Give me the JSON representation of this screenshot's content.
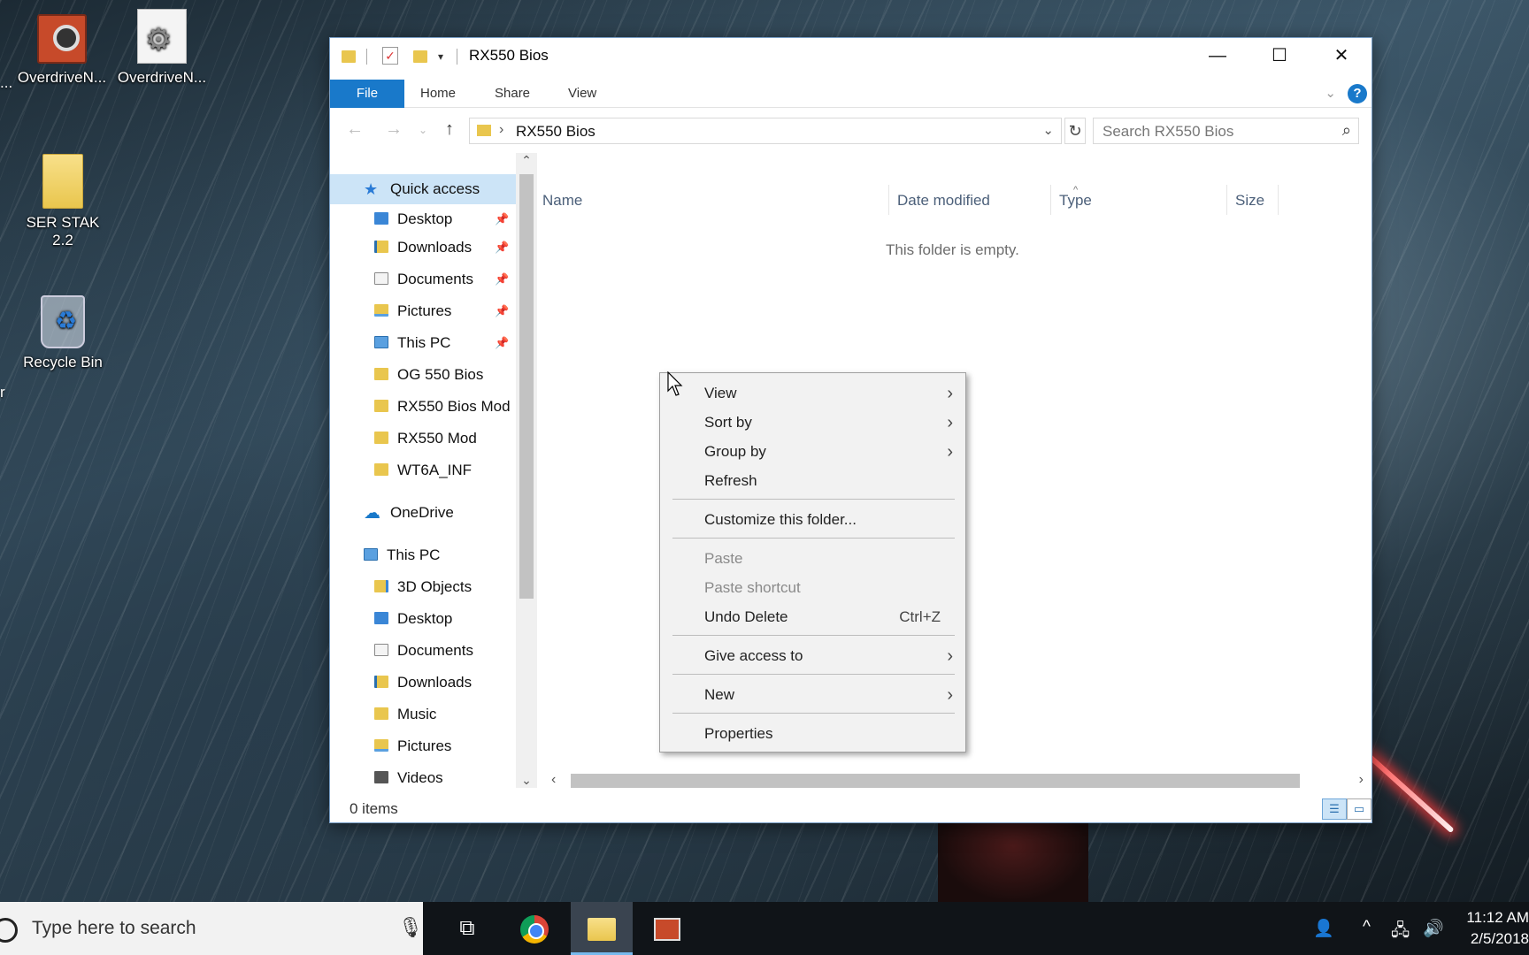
{
  "desktop": {
    "icons": [
      {
        "label": "OverdriveN...",
        "icon": "video-card-icon"
      },
      {
        "label": "OverdriveN...",
        "icon": "settings-file-icon"
      },
      {
        "label": "SER STAK 2.2",
        "icon": "folder-icon"
      },
      {
        "label": "Recycle Bin",
        "icon": "recycle-bin-icon"
      }
    ],
    "left_edge_labels": [
      "...",
      "r"
    ]
  },
  "window": {
    "title": "RX550 Bios",
    "controls": {
      "minimize": "—",
      "maximize": "☐",
      "close": "✕"
    },
    "ribbon": {
      "tabs": [
        "File",
        "Home",
        "Share",
        "View"
      ],
      "help": "?"
    },
    "address": {
      "path": "RX550 Bios",
      "search_placeholder": "Search RX550 Bios"
    },
    "nav_pane": {
      "quick_access": {
        "label": "Quick access",
        "items": [
          {
            "label": "Desktop",
            "pinned": true
          },
          {
            "label": "Downloads",
            "pinned": true
          },
          {
            "label": "Documents",
            "pinned": true
          },
          {
            "label": "Pictures",
            "pinned": true
          },
          {
            "label": "This PC",
            "pinned": true
          },
          {
            "label": "OG 550 Bios",
            "pinned": false
          },
          {
            "label": "RX550 Bios Mod",
            "pinned": false
          },
          {
            "label": "RX550 Mod",
            "pinned": false
          },
          {
            "label": "WT6A_INF",
            "pinned": false
          }
        ]
      },
      "onedrive": "OneDrive",
      "this_pc": {
        "label": "This PC",
        "items": [
          "3D Objects",
          "Desktop",
          "Documents",
          "Downloads",
          "Music",
          "Pictures",
          "Videos"
        ]
      }
    },
    "columns": [
      "Name",
      "Date modified",
      "Type",
      "Size"
    ],
    "empty_message": "This folder is empty.",
    "status": "0 items"
  },
  "context_menu": {
    "items": [
      {
        "label": "View",
        "submenu": true,
        "disabled": false
      },
      {
        "label": "Sort by",
        "submenu": true,
        "disabled": false
      },
      {
        "label": "Group by",
        "submenu": true,
        "disabled": false
      },
      {
        "label": "Refresh",
        "submenu": false,
        "disabled": false
      },
      {
        "label": "Customize this folder...",
        "submenu": false,
        "disabled": false
      },
      {
        "label": "Paste",
        "submenu": false,
        "disabled": true
      },
      {
        "label": "Paste shortcut",
        "submenu": false,
        "disabled": true
      },
      {
        "label": "Undo Delete",
        "shortcut": "Ctrl+Z",
        "submenu": false,
        "disabled": false
      },
      {
        "label": "Give access to",
        "submenu": true,
        "disabled": false
      },
      {
        "label": "New",
        "submenu": true,
        "disabled": false
      },
      {
        "label": "Properties",
        "submenu": false,
        "disabled": false
      }
    ]
  },
  "taskbar": {
    "search_placeholder": "Type here to search",
    "apps": [
      "task-view",
      "chrome",
      "file-explorer",
      "overdrive-app"
    ],
    "clock": {
      "time": "11:12 AM",
      "date": "2/5/2018"
    }
  },
  "colors": {
    "accent": "#1979ca",
    "selection": "#cce4f7",
    "taskbar": "#101418"
  }
}
